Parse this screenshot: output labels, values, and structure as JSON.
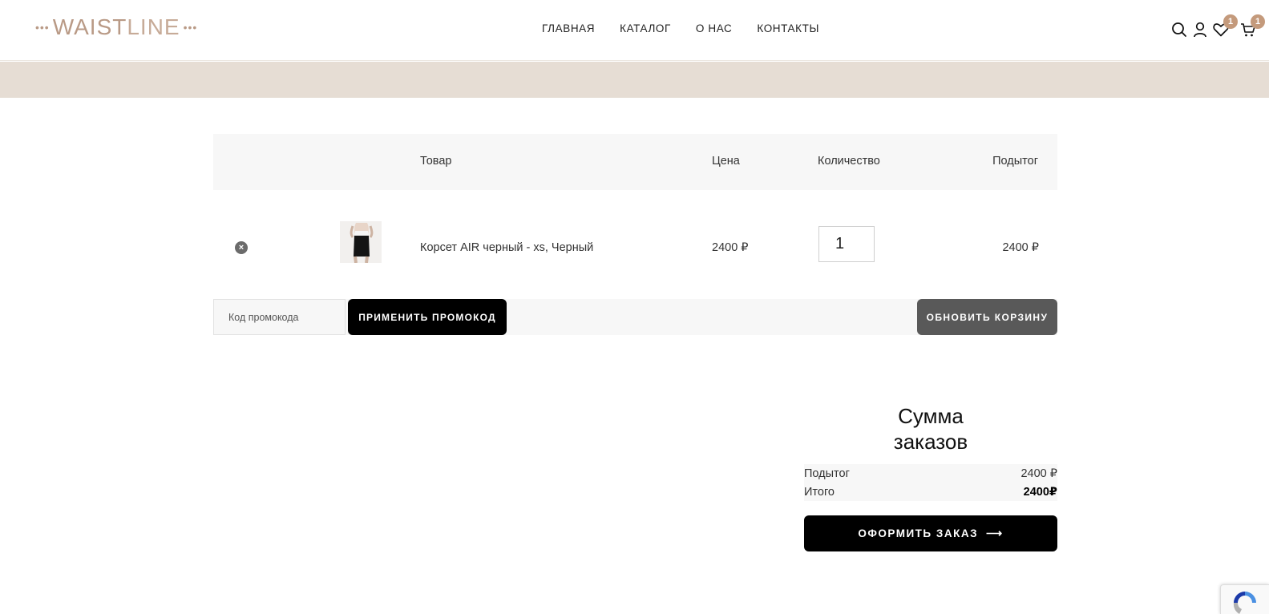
{
  "header": {
    "logo": {
      "dots_left": "•••",
      "text_strong": "WAIST",
      "text_light": "LINE",
      "dots_right": "•••"
    },
    "nav": [
      "ГЛАВНАЯ",
      "КАТАЛОГ",
      "О НАС",
      "КОНТАКТЫ"
    ],
    "icons": [
      "search-icon",
      "user-icon",
      "heart-icon",
      "cart-icon"
    ],
    "wishlist_count": "1",
    "cart_count": "1"
  },
  "cart": {
    "columns": {
      "product": "Товар",
      "price": "Цена",
      "quantity": "Количество",
      "subtotal": "Подытог"
    },
    "items": [
      {
        "name": "Корсет AIR черный - xs, Черный",
        "price": "2400 ₽",
        "quantity": "1",
        "subtotal": "2400 ₽"
      }
    ],
    "promo_placeholder": "Код промокода",
    "apply_label": "ПРИМЕНИТЬ ПРОМОКОД",
    "update_label": "ОБНОВИТЬ КОРЗИНУ"
  },
  "totals": {
    "title_line1": "Сумма",
    "title_line2": "заказов",
    "subtotal_label": "Подытог",
    "subtotal_value": "2400 ₽",
    "total_label": "Итого",
    "total_value": "2400₽",
    "checkout_label": "ОФОРМИТЬ ЗАКАЗ",
    "checkout_arrow": "⟶"
  },
  "colors": {
    "accent": "#c49a7c",
    "band": "#e6ddd4",
    "dark": "#000000",
    "update_button": "#595959"
  }
}
